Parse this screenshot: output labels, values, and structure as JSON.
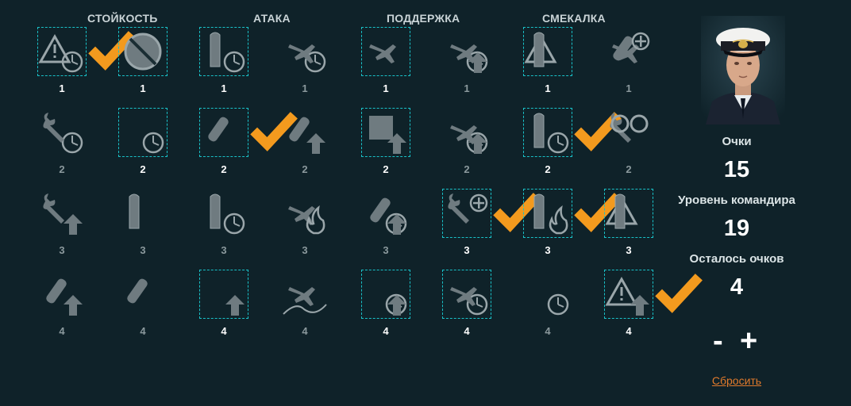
{
  "categories": [
    "СТОЙКОСТЬ",
    "АТАКА",
    "ПОДДЕРЖКА",
    "СМЕКАЛКА"
  ],
  "colors": {
    "selected_border": "#19c1c8",
    "checkmark": "#f39a1e",
    "reset_link": "#e07a2c",
    "background": "#0f2229"
  },
  "skills": [
    {
      "tier": "1",
      "icon": "warning-crosshair-icon",
      "selected": true,
      "checked": true
    },
    {
      "tier": "1",
      "icon": "no-fire-icon",
      "selected": true,
      "checked": false
    },
    {
      "tier": "1",
      "icon": "torpedo-timer-icon",
      "selected": true,
      "checked": false
    },
    {
      "tier": "1",
      "icon": "plane-timer-icon",
      "selected": false,
      "checked": false
    },
    {
      "tier": "1",
      "icon": "plane-formation-icon",
      "selected": true,
      "checked": false
    },
    {
      "tier": "1",
      "icon": "plane-target-arrow-icon",
      "selected": false,
      "checked": false
    },
    {
      "tier": "1",
      "icon": "ship-warning-icon",
      "selected": true,
      "checked": false
    },
    {
      "tier": "1",
      "icon": "bomb-plane-plus-icon",
      "selected": false,
      "checked": false
    },
    {
      "tier": "2",
      "icon": "wrench-timer-icon",
      "selected": false,
      "checked": false
    },
    {
      "tier": "2",
      "icon": "stopwatch-icon",
      "selected": true,
      "checked": false
    },
    {
      "tier": "2",
      "icon": "shell-burst-icon",
      "selected": true,
      "checked": true
    },
    {
      "tier": "2",
      "icon": "rocket-arrow-icon",
      "selected": false,
      "checked": false
    },
    {
      "tier": "2",
      "icon": "armor-arrow-icon",
      "selected": true,
      "checked": false
    },
    {
      "tier": "2",
      "icon": "plane-crosshair-arrow-icon",
      "selected": false,
      "checked": false
    },
    {
      "tier": "2",
      "icon": "ships-timer-icon",
      "selected": true,
      "checked": true
    },
    {
      "tier": "2",
      "icon": "propeller-wrench-icon",
      "selected": false,
      "checked": false
    },
    {
      "tier": "3",
      "icon": "wrench-arrow-icon",
      "selected": false,
      "checked": false
    },
    {
      "tier": "3",
      "icon": "battleship-icon",
      "selected": false,
      "checked": false
    },
    {
      "tier": "3",
      "icon": "torpedoes-timer-icon",
      "selected": false,
      "checked": false
    },
    {
      "tier": "3",
      "icon": "plane-fire-icon",
      "selected": false,
      "checked": false
    },
    {
      "tier": "3",
      "icon": "target-shells-arrow-icon",
      "selected": false,
      "checked": false
    },
    {
      "tier": "3",
      "icon": "heal-repair-icon",
      "selected": true,
      "checked": true
    },
    {
      "tier": "3",
      "icon": "ship-fire-icon",
      "selected": true,
      "checked": true
    },
    {
      "tier": "3",
      "icon": "torpedoes-warning-icon",
      "selected": true,
      "checked": false
    },
    {
      "tier": "4",
      "icon": "shells-arrow-icon",
      "selected": false,
      "checked": false
    },
    {
      "tier": "4",
      "icon": "extinguisher-icon",
      "selected": false,
      "checked": false
    },
    {
      "tier": "4",
      "icon": "crossed-arrow-icon",
      "selected": true,
      "checked": false
    },
    {
      "tier": "4",
      "icon": "planes-map-icon",
      "selected": false,
      "checked": false
    },
    {
      "tier": "4",
      "icon": "targets-double-arrow-icon",
      "selected": true,
      "checked": false
    },
    {
      "tier": "4",
      "icon": "plane-target-icon",
      "selected": true,
      "checked": false
    },
    {
      "tier": "4",
      "icon": "radar-icon",
      "selected": false,
      "checked": false
    },
    {
      "tier": "4",
      "icon": "warning-down-arrow-icon",
      "selected": true,
      "checked": true
    }
  ],
  "panel": {
    "points_label": "Очки",
    "points_value": "15",
    "level_label": "Уровень командира",
    "level_value": "19",
    "remaining_label": "Осталось очков",
    "remaining_value": "4",
    "minus_label": "-",
    "plus_label": "+",
    "reset_label": "Сбросить",
    "portrait_icon": "commander-portrait"
  }
}
